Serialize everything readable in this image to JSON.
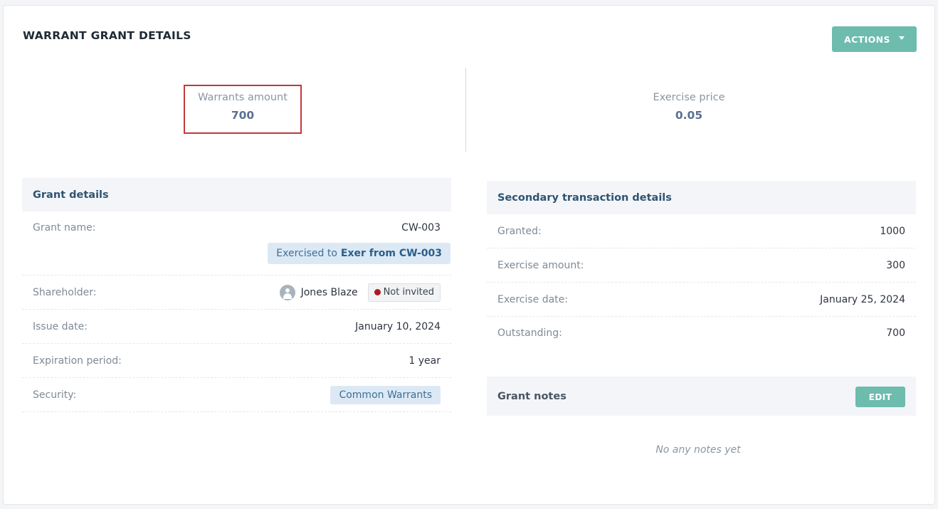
{
  "header": {
    "title": "WARRANT GRANT DETAILS",
    "actions_label": "ACTIONS"
  },
  "summary": {
    "warrants_amount_label": "Warrants amount",
    "warrants_amount_value": "700",
    "exercise_price_label": "Exercise price",
    "exercise_price_value": "0.05"
  },
  "grant_details": {
    "title": "Grant details",
    "grant_name_label": "Grant name:",
    "grant_name_value": "CW-003",
    "exercised_prefix": "Exercised to",
    "exercised_link": "Exer from CW-003",
    "shareholder_label": "Shareholder:",
    "shareholder_name": "Jones Blaze",
    "shareholder_status": "Not invited",
    "issue_date_label": "Issue date:",
    "issue_date_value": "January 10, 2024",
    "expiration_label": "Expiration period:",
    "expiration_value": "1 year",
    "security_label": "Security:",
    "security_value": "Common Warrants"
  },
  "secondary": {
    "title": "Secondary transaction details",
    "rows": [
      {
        "label": "Granted:",
        "value": "1000"
      },
      {
        "label": "Exercise amount:",
        "value": "300"
      },
      {
        "label": "Exercise date:",
        "value": "January 25, 2024"
      },
      {
        "label": "Outstanding:",
        "value": "700"
      }
    ]
  },
  "notes": {
    "title": "Grant notes",
    "edit_label": "EDIT",
    "empty_text": "No any notes yet"
  },
  "colors": {
    "accent": "#6dbcae",
    "highlight_border": "#c0393b",
    "status_dot": "#b01820"
  }
}
